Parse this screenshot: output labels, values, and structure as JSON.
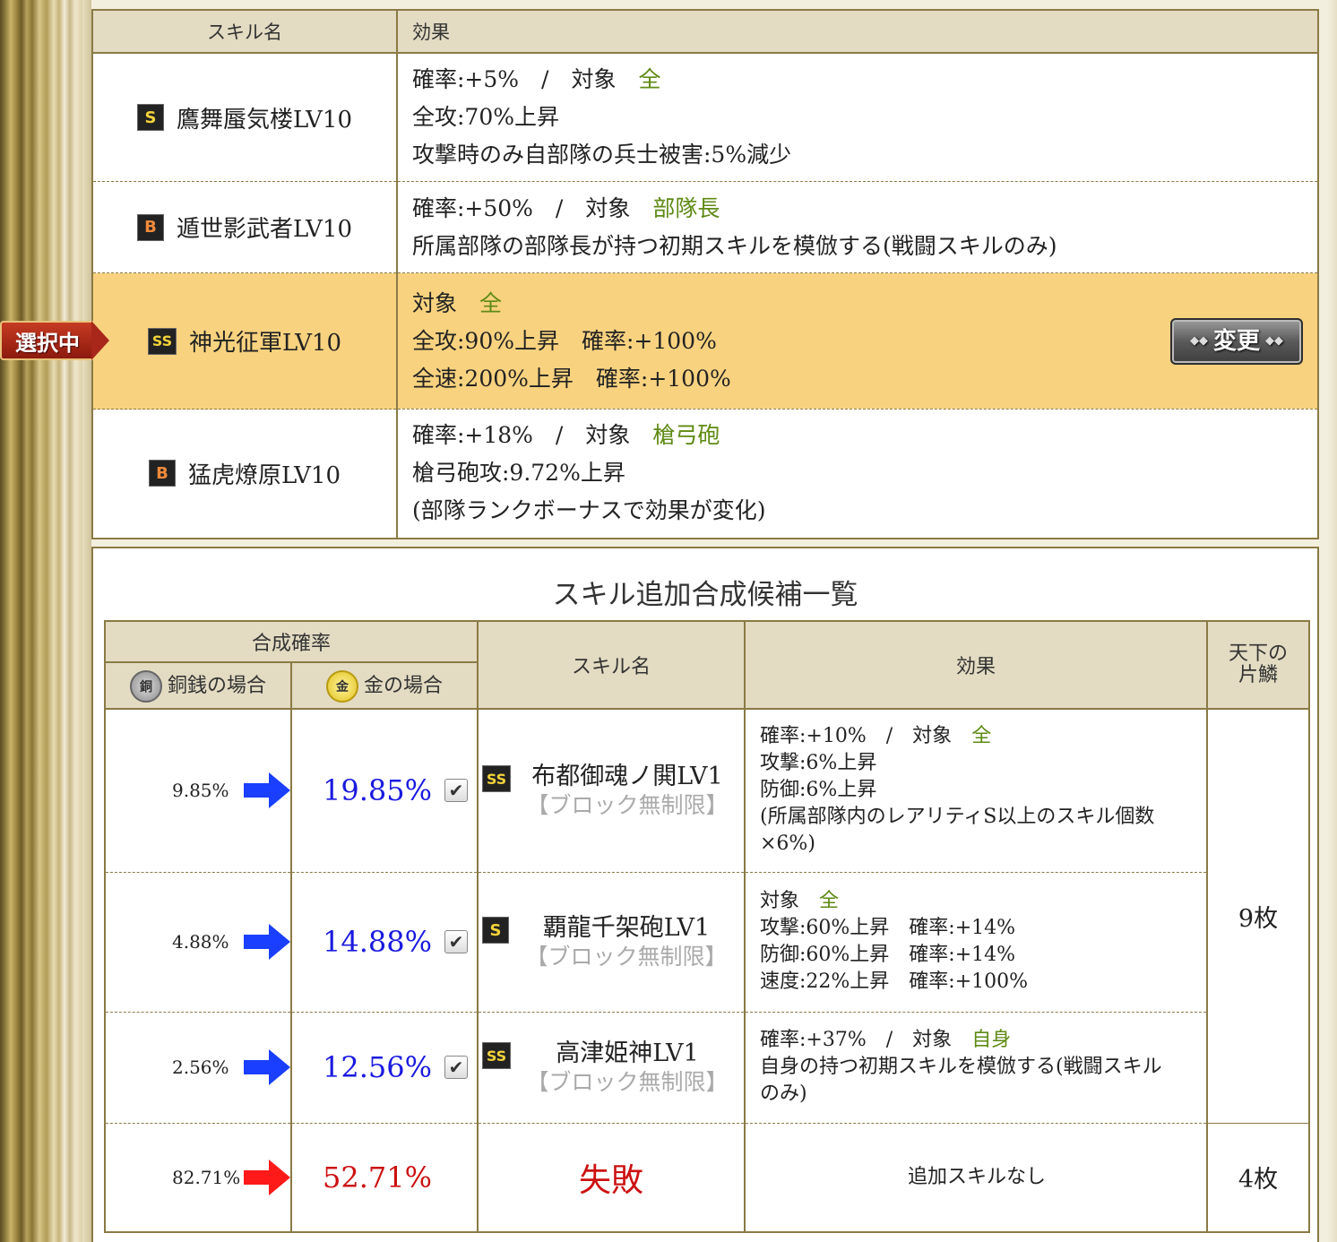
{
  "top_table": {
    "header_name": "スキル名",
    "header_effect": "効果",
    "rows": [
      {
        "rank": "S",
        "name": "鷹舞蜃気楼LV10",
        "lines": [
          "確率:+5%　/　対象",
          "全",
          "全攻:70%上昇",
          "攻撃時のみ自部隊の兵士被害:5%減少"
        ]
      },
      {
        "rank": "B",
        "name": "遁世影武者LV10",
        "lines": [
          "確率:+50%　/　対象",
          "部隊長",
          "所属部隊の部隊長が持つ初期スキルを模倣する(戦闘スキルのみ)"
        ]
      },
      {
        "rank": "SS",
        "name": "神光征軍LV10",
        "lines": [
          "対象",
          "全",
          "全攻:90%上昇　確率:+100%",
          "全速:200%上昇　確率:+100%"
        ]
      },
      {
        "rank": "B",
        "name": "猛虎燎原LV10",
        "lines": [
          "確率:+18%　/　対象",
          "槍弓砲",
          "槍弓砲攻:9.72%上昇",
          "(部隊ランクボーナスで効果が変化)"
        ]
      }
    ],
    "change_button": "変更",
    "selected_tag": "選択中"
  },
  "candidates": {
    "title": "スキル追加合成候補一覧",
    "header_rate": "合成確率",
    "header_copper": "銅銭の場合",
    "header_gold": "金の場合",
    "coin_copper": "銅",
    "coin_gold": "金",
    "header_skill": "スキル名",
    "header_effect": "効果",
    "header_scale_1": "天下の",
    "header_scale_2": "片鱗",
    "block_note": "【ブロック無制限】",
    "rows": [
      {
        "copper": "9.85%",
        "gold": "19.85%",
        "rank": "SS",
        "name": "布都御魂ノ閧LV1",
        "eff": [
          "確率:+10%　/　対象",
          "全",
          "攻撃:6%上昇",
          "防御:6%上昇",
          "(所属部隊内のレアリティS以上のスキル個数",
          "×6%)"
        ]
      },
      {
        "copper": "4.88%",
        "gold": "14.88%",
        "rank": "S",
        "name": "覇龍千架砲LV1",
        "eff": [
          "対象",
          "全",
          "攻撃:60%上昇　確率:+14%",
          "防御:60%上昇　確率:+14%",
          "速度:22%上昇　確率:+100%"
        ]
      },
      {
        "copper": "2.56%",
        "gold": "12.56%",
        "rank": "SS",
        "name": "高津姫神LV1",
        "eff": [
          "確率:+37%　/　対象",
          "自身",
          "自身の持つ初期スキルを模倣する(戦闘スキル",
          "のみ)"
        ]
      }
    ],
    "fail_row": {
      "copper": "82.71%",
      "gold": "52.71%",
      "label": "失敗",
      "effect": "追加スキルなし",
      "scale": "4枚"
    },
    "scale_success": "9枚",
    "colors": {
      "arrow_success": "#1a3fff",
      "arrow_fail": "#ff1a1a",
      "accent_green": "#5e8a14"
    }
  }
}
